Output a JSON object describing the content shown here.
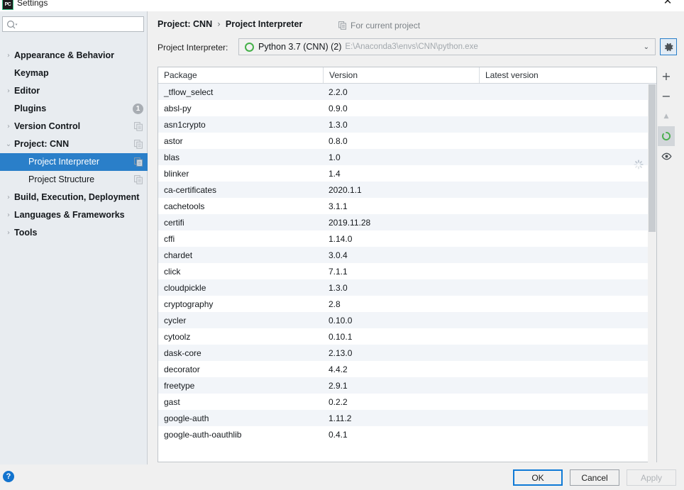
{
  "window": {
    "title": "Settings",
    "app_icon_text": "PC",
    "close_icon": "close-icon",
    "close_glyph": "✕"
  },
  "sidebar": {
    "search": {
      "value": "",
      "placeholder": "",
      "icon": "search-icon"
    },
    "items": [
      {
        "label": "Appearance & Behavior",
        "arrow": "›",
        "expandable": true,
        "bold": true,
        "indent": 0,
        "selected": false,
        "copy_icon": false,
        "badge": null
      },
      {
        "label": "Keymap",
        "arrow": "",
        "expandable": false,
        "bold": true,
        "indent": 0,
        "selected": false,
        "copy_icon": false,
        "badge": null
      },
      {
        "label": "Editor",
        "arrow": "›",
        "expandable": true,
        "bold": true,
        "indent": 0,
        "selected": false,
        "copy_icon": false,
        "badge": null
      },
      {
        "label": "Plugins",
        "arrow": "",
        "expandable": false,
        "bold": true,
        "indent": 0,
        "selected": false,
        "copy_icon": false,
        "badge": "1"
      },
      {
        "label": "Version Control",
        "arrow": "›",
        "expandable": true,
        "bold": true,
        "indent": 0,
        "selected": false,
        "copy_icon": true,
        "badge": null
      },
      {
        "label": "Project: CNN",
        "arrow": "⌄",
        "expandable": true,
        "bold": true,
        "indent": 0,
        "selected": false,
        "copy_icon": true,
        "badge": null
      },
      {
        "label": "Project Interpreter",
        "arrow": "",
        "expandable": false,
        "bold": false,
        "indent": 1,
        "selected": true,
        "copy_icon": true,
        "badge": null
      },
      {
        "label": "Project Structure",
        "arrow": "",
        "expandable": false,
        "bold": false,
        "indent": 1,
        "selected": false,
        "copy_icon": true,
        "badge": null
      },
      {
        "label": "Build, Execution, Deployment",
        "arrow": "›",
        "expandable": true,
        "bold": true,
        "indent": 0,
        "selected": false,
        "copy_icon": false,
        "badge": null
      },
      {
        "label": "Languages & Frameworks",
        "arrow": "›",
        "expandable": true,
        "bold": true,
        "indent": 0,
        "selected": false,
        "copy_icon": false,
        "badge": null
      },
      {
        "label": "Tools",
        "arrow": "›",
        "expandable": true,
        "bold": true,
        "indent": 0,
        "selected": false,
        "copy_icon": false,
        "badge": null
      }
    ]
  },
  "main": {
    "breadcrumb": {
      "parent": "Project: CNN",
      "separator": "›",
      "current": "Project Interpreter"
    },
    "scope_note": {
      "label": "For current project",
      "icon": "copy-icon"
    },
    "interpreter": {
      "label": "Project Interpreter:",
      "name": "Python 3.7 (CNN) (2)",
      "path": "E:\\Anaconda3\\envs\\CNN\\python.exe",
      "dropdown_arrow": "⌄",
      "status_color": "#45b049",
      "gear_icon": "gear-icon"
    },
    "table": {
      "columns": [
        "Package",
        "Version",
        "Latest version"
      ],
      "rows": [
        {
          "package": "_tflow_select",
          "version": "2.2.0",
          "latest": ""
        },
        {
          "package": "absl-py",
          "version": "0.9.0",
          "latest": ""
        },
        {
          "package": "asn1crypto",
          "version": "1.3.0",
          "latest": ""
        },
        {
          "package": "astor",
          "version": "0.8.0",
          "latest": ""
        },
        {
          "package": "blas",
          "version": "1.0",
          "latest": ""
        },
        {
          "package": "blinker",
          "version": "1.4",
          "latest": ""
        },
        {
          "package": "ca-certificates",
          "version": "2020.1.1",
          "latest": ""
        },
        {
          "package": "cachetools",
          "version": "3.1.1",
          "latest": ""
        },
        {
          "package": "certifi",
          "version": "2019.11.28",
          "latest": ""
        },
        {
          "package": "cffi",
          "version": "1.14.0",
          "latest": ""
        },
        {
          "package": "chardet",
          "version": "3.0.4",
          "latest": ""
        },
        {
          "package": "click",
          "version": "7.1.1",
          "latest": ""
        },
        {
          "package": "cloudpickle",
          "version": "1.3.0",
          "latest": ""
        },
        {
          "package": "cryptography",
          "version": "2.8",
          "latest": ""
        },
        {
          "package": "cycler",
          "version": "0.10.0",
          "latest": ""
        },
        {
          "package": "cytoolz",
          "version": "0.10.1",
          "latest": ""
        },
        {
          "package": "dask-core",
          "version": "2.13.0",
          "latest": ""
        },
        {
          "package": "decorator",
          "version": "4.4.2",
          "latest": ""
        },
        {
          "package": "freetype",
          "version": "2.9.1",
          "latest": ""
        },
        {
          "package": "gast",
          "version": "0.2.2",
          "latest": ""
        },
        {
          "package": "google-auth",
          "version": "1.11.2",
          "latest": ""
        },
        {
          "package": "google-auth-oauthlib",
          "version": "0.4.1",
          "latest": ""
        }
      ],
      "loading_indicator": "loading-spinner-icon"
    },
    "toolbar": [
      {
        "name": "add-package-button",
        "glyph": "+",
        "state": "enabled"
      },
      {
        "name": "remove-package-button",
        "glyph": "−",
        "state": "enabled"
      },
      {
        "name": "upgrade-package-button",
        "glyph": "▲",
        "state": "disabled"
      },
      {
        "name": "refresh-button",
        "glyph": "○",
        "state": "active"
      },
      {
        "name": "show-early-releases-button",
        "glyph": "◉",
        "state": "enabled"
      }
    ]
  },
  "footer": {
    "help_label": "?",
    "ok_label": "OK",
    "cancel_label": "Cancel",
    "apply_label": "Apply",
    "apply_enabled": false
  },
  "colors": {
    "accent": "#2a7fc9",
    "focus_border": "#0f7ad6",
    "sidebar_bg": "#e8ecf0",
    "row_alt": "#f2f5f9",
    "python_ok": "#45b049",
    "help_blue": "#1273ce"
  }
}
